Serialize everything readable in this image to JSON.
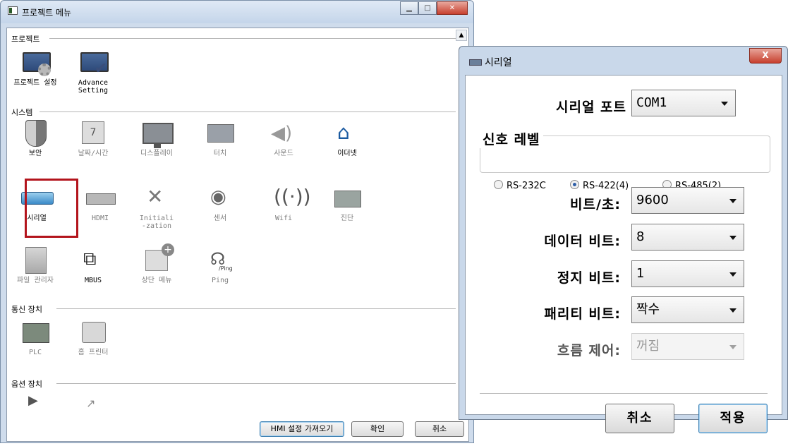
{
  "main_window": {
    "title": "프로젝트 메뉴",
    "sections": {
      "project": "프로젝트",
      "system": "시스템",
      "comm": "통신 장치",
      "option": "옵션 장치"
    },
    "items": {
      "project_settings": "프로젝트 설정",
      "advance_setting": "Advance\nSetting",
      "security": "보안",
      "date_time": "날짜/시간",
      "display": "디스플레이",
      "touch": "터치",
      "sound": "사운드",
      "ethernet": "이더넷",
      "serial": "시리얼",
      "hdmi": "HDMI",
      "initialization": "Initiali\n-zation",
      "sensor": "센서",
      "wifi": "Wifi",
      "diagnosis": "진단",
      "file_manager": "파일 관리자",
      "mbus": "MBUS",
      "top_menu": "상단 메뉴",
      "ping": "Ping",
      "plc": "PLC",
      "home_printer": "홈 프린터",
      "ping_icon_text": "/Ping",
      "calendar_digit": "7"
    },
    "buttons": {
      "hmi_import": "HMI 설정 가져오기",
      "ok": "확인",
      "cancel": "취소"
    }
  },
  "serial_dialog": {
    "title": "시리얼",
    "serial_port_label": "시리얼 포트",
    "serial_port_value": "COM1",
    "signal_level_label": "신호 레벨",
    "radios": [
      {
        "label": "RS-232C",
        "checked": false
      },
      {
        "label": "RS-422(4)",
        "checked": true
      },
      {
        "label": "RS-485(2)",
        "checked": false
      }
    ],
    "baud_label": "비트/초:",
    "baud_value": "9600",
    "data_bits_label": "데이터 비트:",
    "data_bits_value": "8",
    "stop_bits_label": "정지 비트:",
    "stop_bits_value": "1",
    "parity_label": "패리티 비트:",
    "parity_value": "짝수",
    "flow_label": "흐름 제어:",
    "flow_value": "꺼짐",
    "cancel": "취소",
    "apply": "적용",
    "close_glyph": "X"
  }
}
